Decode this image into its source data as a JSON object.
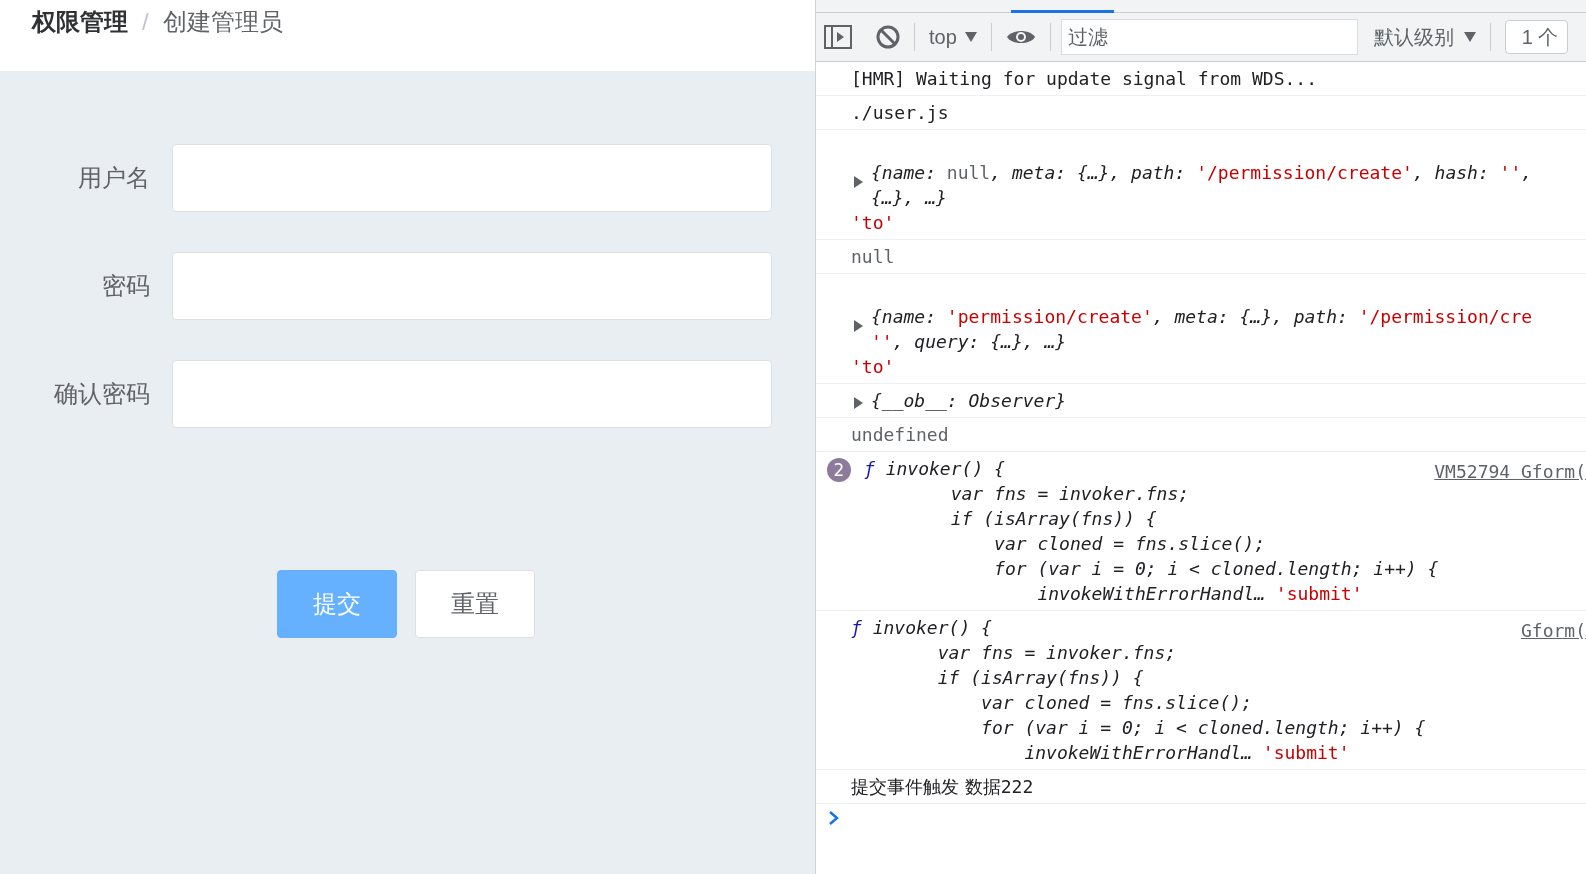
{
  "breadcrumb": [
    {
      "label": "权限管理",
      "current": false
    },
    {
      "label": "创建管理员",
      "current": true
    }
  ],
  "breadcrumb_separator": "/",
  "form": {
    "fields": [
      {
        "label": "用户名"
      },
      {
        "label": "密码"
      },
      {
        "label": "确认密码"
      }
    ],
    "buttons": [
      {
        "label": "提交",
        "primary": true
      },
      {
        "label": "重置",
        "primary": false
      }
    ]
  },
  "console": {
    "toolbar": {
      "context": "top",
      "filter_placeholder": "过滤",
      "level": "默认级别",
      "issues": "1 个"
    },
    "messages": [
      {
        "lines": [
          [
            {
              "kind": "plain",
              "text": "[HMR] Waiting for update signal from WDS..."
            }
          ]
        ]
      },
      {
        "lines": [
          [
            {
              "kind": "plain",
              "text": "./user.js"
            }
          ]
        ]
      },
      {
        "tall": true,
        "expandable": true,
        "lines": [
          [
            {
              "kind": "key",
              "text": "{name: "
            },
            {
              "kind": "muted",
              "text": "null"
            },
            {
              "kind": "key",
              "text": ", meta: {…}, path: "
            },
            {
              "kind": "str",
              "text": "'/permission/create'"
            },
            {
              "kind": "key",
              "text": ", hash: "
            },
            {
              "kind": "str",
              "text": "''"
            },
            {
              "kind": "key",
              "text": ","
            }
          ],
          [
            {
              "kind": "key",
              "text": "{…}, …}"
            }
          ],
          [
            {
              "kind": "str",
              "text": "'to'",
              "outdent": true
            }
          ]
        ]
      },
      {
        "lines": [
          [
            {
              "kind": "muted",
              "text": "null"
            }
          ]
        ]
      },
      {
        "tall": true,
        "expandable": true,
        "lines": [
          [
            {
              "kind": "key",
              "text": "{name: "
            },
            {
              "kind": "str",
              "text": "'permission/create'"
            },
            {
              "kind": "key",
              "text": ", meta: {…}, path: "
            },
            {
              "kind": "str",
              "text": "'/permission/cre"
            }
          ],
          [
            {
              "kind": "str",
              "text": "''"
            },
            {
              "kind": "key",
              "text": ", query: {…}, …}"
            }
          ],
          [
            {
              "kind": "str",
              "text": "'to'",
              "outdent": true
            }
          ]
        ]
      },
      {
        "expandable": true,
        "lines": [
          [
            {
              "kind": "key",
              "text": "{__ob__: Observer}"
            }
          ]
        ]
      },
      {
        "lines": [
          [
            {
              "kind": "muted",
              "text": "undefined"
            }
          ]
        ]
      },
      {
        "count": "2",
        "source": "VM52794 Gform(",
        "lines": [
          [
            {
              "kind": "fn",
              "text": "ƒ"
            },
            {
              "kind": "key",
              "text": " invoker() {"
            }
          ],
          [
            {
              "kind": "key",
              "text": "        var fns = invoker.fns;"
            }
          ],
          [
            {
              "kind": "key",
              "text": "        if (isArray(fns)) {"
            }
          ],
          [
            {
              "kind": "key",
              "text": "            var cloned = fns.slice();"
            }
          ],
          [
            {
              "kind": "key",
              "text": "            for (var i = 0; i < cloned.length; i++) {"
            }
          ],
          [
            {
              "kind": "key",
              "text": "                invokeWithErrorHandl… "
            },
            {
              "kind": "str",
              "text": "'submit'"
            }
          ]
        ]
      },
      {
        "source": "Gform(",
        "lines": [
          [
            {
              "kind": "fn",
              "text": "ƒ"
            },
            {
              "kind": "key",
              "text": " invoker() {"
            }
          ],
          [
            {
              "kind": "key",
              "text": "        var fns = invoker.fns;"
            }
          ],
          [
            {
              "kind": "key",
              "text": "        if (isArray(fns)) {"
            }
          ],
          [
            {
              "kind": "key",
              "text": "            var cloned = fns.slice();"
            }
          ],
          [
            {
              "kind": "key",
              "text": "            for (var i = 0; i < cloned.length; i++) {"
            }
          ],
          [
            {
              "kind": "key",
              "text": "                invokeWithErrorHandl… "
            },
            {
              "kind": "str",
              "text": "'submit'"
            }
          ]
        ]
      },
      {
        "lines": [
          [
            {
              "kind": "cjk",
              "text": "提交事件触发 数据"
            },
            {
              "kind": "plain",
              "text": "222"
            }
          ]
        ]
      }
    ]
  }
}
